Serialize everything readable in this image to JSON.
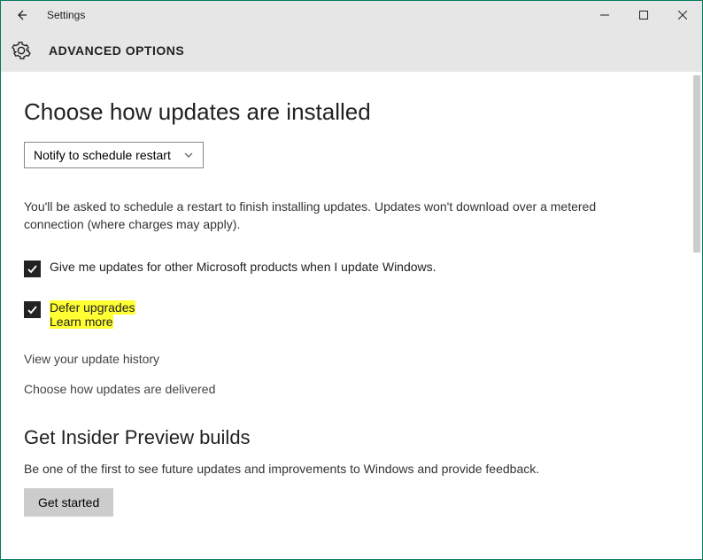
{
  "window": {
    "title": "Settings"
  },
  "header": {
    "title": "ADVANCED OPTIONS"
  },
  "main": {
    "section1_heading": "Choose how updates are installed",
    "dropdown_value": "Notify to schedule restart",
    "description": "You'll be asked to schedule a restart to finish installing updates. Updates won't download over a metered connection (where charges may apply).",
    "checkbox1": {
      "checked": true,
      "label": "Give me updates for other Microsoft products when I update Windows."
    },
    "checkbox2": {
      "checked": true,
      "label": "Defer upgrades",
      "learn_more": "Learn more"
    },
    "link_history": "View your update history",
    "link_delivered": "Choose how updates are delivered",
    "section2_heading": "Get Insider Preview builds",
    "section2_text": "Be one of the first to see future updates and improvements to Windows and provide feedback.",
    "get_started_button": "Get started"
  }
}
